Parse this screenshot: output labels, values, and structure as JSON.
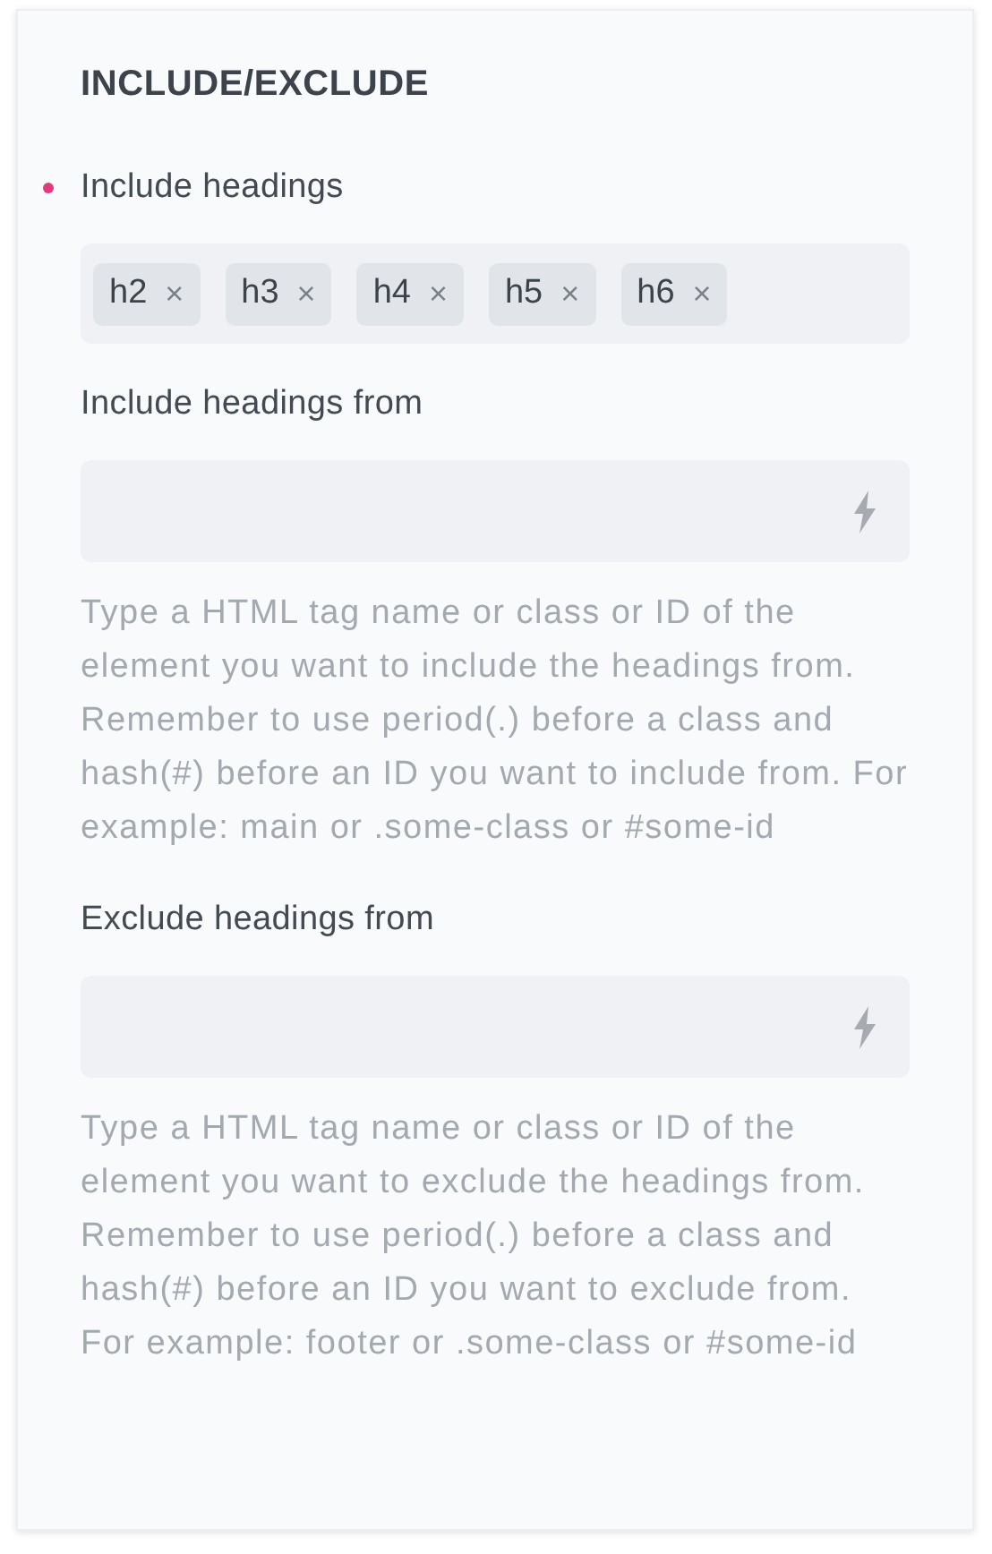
{
  "panel": {
    "title": "INCLUDE/EXCLUDE"
  },
  "fields": [
    {
      "kind": "tags",
      "label": "Include headings",
      "modified": true,
      "tags": [
        {
          "text": "h2",
          "remove": "×"
        },
        {
          "text": "h3",
          "remove": "×"
        },
        {
          "text": "h4",
          "remove": "×"
        },
        {
          "text": "h5",
          "remove": "×"
        },
        {
          "text": "h6",
          "remove": "×"
        }
      ]
    },
    {
      "kind": "text",
      "label": "Include headings from",
      "modified": false,
      "help": "Type a HTML tag name or class or ID of the element you want to include the headings from. Remember to use period(.) before a class and hash(#) before an ID you want to include from. For example: main or .some-class or #some-id"
    },
    {
      "kind": "text",
      "label": "Exclude headings from",
      "modified": false,
      "help": "Type a HTML tag name or class or ID of the element you want to exclude the headings from. Remember to use period(.) before a class and hash(#) before an ID you want to exclude from. For example: footer or .some-class or #some-id"
    }
  ]
}
